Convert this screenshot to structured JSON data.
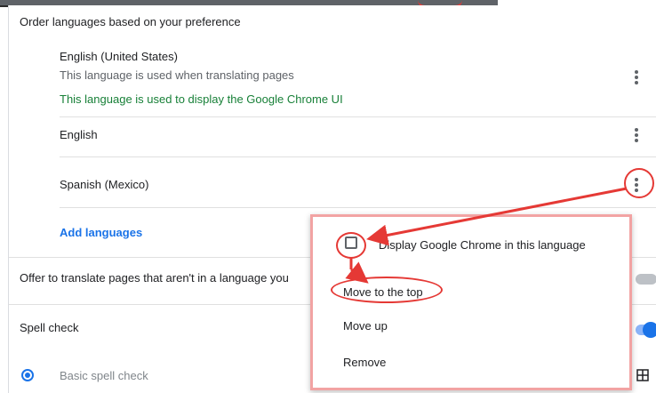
{
  "section": {
    "title": "Order languages based on your preference"
  },
  "languages": [
    {
      "name": "English (United States)",
      "sub": "This language is used when translating pages",
      "ui_note": "This language is used to display the Google Chrome UI"
    },
    {
      "name": "English"
    },
    {
      "name": "Spanish (Mexico)"
    }
  ],
  "add_languages_label": "Add languages",
  "translate_offer": {
    "label": "Offer to translate pages that aren't in a language you",
    "enabled": false
  },
  "spell_check": {
    "label": "Spell check",
    "enabled": true,
    "basic_label": "Basic spell check"
  },
  "context_menu": {
    "items": [
      {
        "label": "Display Google Chrome in this language",
        "checked": false
      },
      {
        "label": "Move to the top"
      },
      {
        "label": "Move up"
      },
      {
        "label": "Remove"
      }
    ]
  },
  "colors": {
    "accent": "#1a73e8",
    "ui_note_green": "#188038",
    "annotation_red": "#e53935"
  }
}
